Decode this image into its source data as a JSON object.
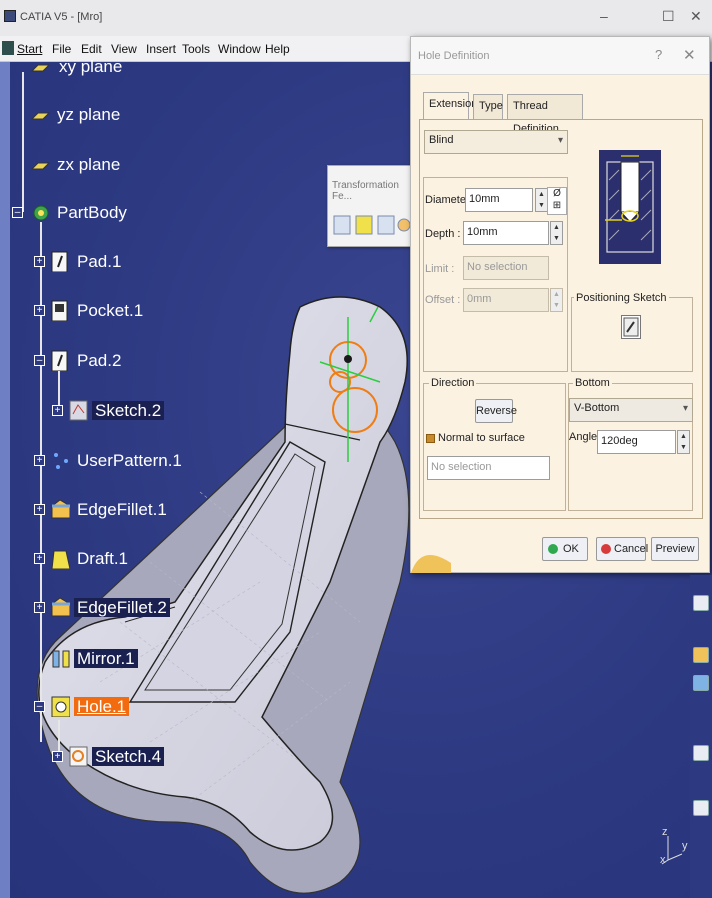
{
  "window": {
    "title": "CATIA V5 - [Mro]",
    "min": "–",
    "max": "☐",
    "close": "✕"
  },
  "menubar": {
    "items": [
      "Start",
      "File",
      "Edit",
      "View",
      "Insert",
      "Tools",
      "Window",
      "Help"
    ]
  },
  "tree": {
    "nodes": [
      {
        "label": "xy plane"
      },
      {
        "label": "yz plane"
      },
      {
        "label": "zx plane"
      },
      {
        "label": "PartBody"
      },
      {
        "label": "Pad.1"
      },
      {
        "label": "Pocket.1"
      },
      {
        "label": "Pad.2"
      },
      {
        "label": "Sketch.2"
      },
      {
        "label": "UserPattern.1"
      },
      {
        "label": "EdgeFillet.1"
      },
      {
        "label": "Draft.1"
      },
      {
        "label": "EdgeFillet.2"
      },
      {
        "label": "Mirror.1"
      },
      {
        "label": "Hole.1"
      },
      {
        "label": "Sketch.4"
      }
    ]
  },
  "floating_toolbar": {
    "title": "Transformation Fe..."
  },
  "dialog": {
    "title": "Hole Definition",
    "help": "?",
    "close": "✕",
    "tabs": [
      "Extension",
      "Type",
      "Thread Definition"
    ],
    "extension_type": "Blind",
    "diameter": {
      "label": "Diameter :",
      "value": "10mm"
    },
    "diameter_symbol": "Ø",
    "depth": {
      "label": "Depth :",
      "value": "10mm"
    },
    "limit": {
      "label": "Limit :",
      "value": "No selection"
    },
    "offset": {
      "label": "Offset :",
      "value": "0mm"
    },
    "positioning_sketch": "Positioning Sketch",
    "direction": {
      "title": "Direction",
      "reverse": "Reverse",
      "normal_to_surface": "Normal to surface",
      "selection": "No selection"
    },
    "bottom": {
      "title": "Bottom",
      "type": "V-Bottom",
      "angle_label": "Angle :",
      "angle_value": "120deg"
    },
    "buttons": {
      "ok": "OK",
      "cancel": "Cancel",
      "preview": "Preview"
    }
  },
  "compass": {
    "axis_z": "z",
    "axis_y": "y",
    "axis_x": "x"
  }
}
